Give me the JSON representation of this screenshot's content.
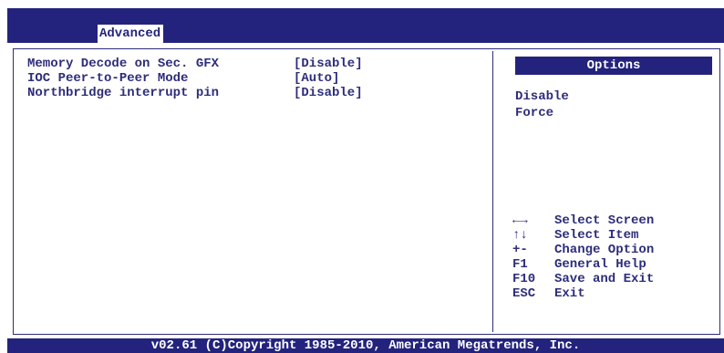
{
  "tabs": [
    {
      "label": "Advanced"
    }
  ],
  "settings": [
    {
      "label": "Memory Decode on Sec. GFX",
      "value": "[Disable]"
    },
    {
      "label": "IOC Peer-to-Peer Mode",
      "value": "[Auto]"
    },
    {
      "label": "Northbridge interrupt pin",
      "value": "[Disable]"
    }
  ],
  "help_panel": {
    "title": "Options",
    "options": [
      "Disable",
      "Force"
    ]
  },
  "key_help": [
    {
      "key": "←→",
      "desc": "Select Screen"
    },
    {
      "key": "↑↓",
      "desc": "Select Item"
    },
    {
      "key": "+-",
      "desc": "Change Option"
    },
    {
      "key": "F1",
      "desc": "General Help"
    },
    {
      "key": "F10",
      "desc": "Save and Exit"
    },
    {
      "key": "ESC",
      "desc": "Exit"
    }
  ],
  "footer": "v02.61 (C)Copyright 1985-2010, American Megatrends, Inc.",
  "colors": {
    "primary": "#23237e",
    "text": "#2d2d7a",
    "background": "#ffffff"
  }
}
